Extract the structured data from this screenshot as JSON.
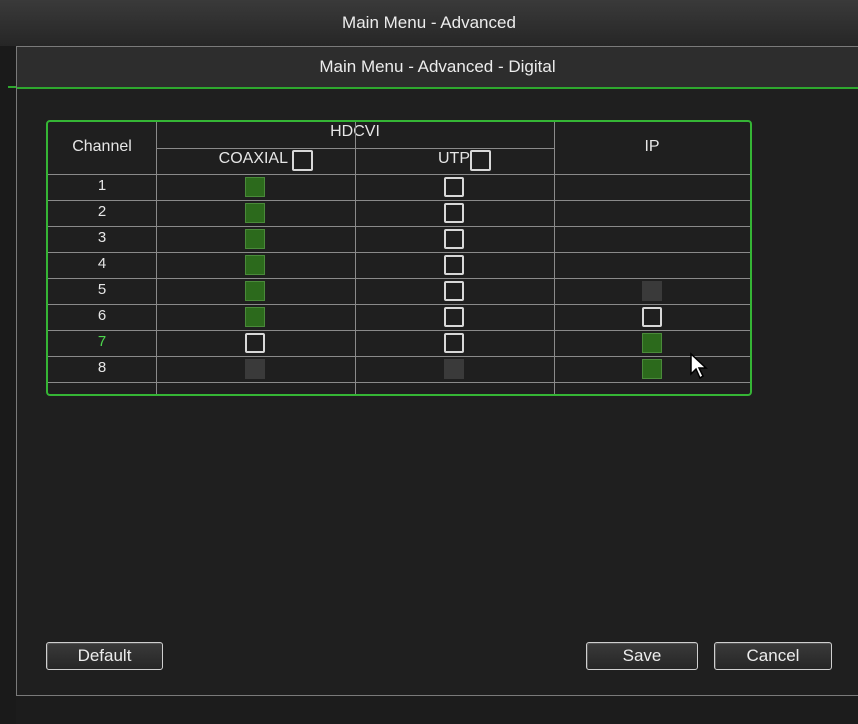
{
  "window": {
    "title": "Main Menu - Advanced"
  },
  "dialog": {
    "title": "Main Menu - Advanced - Digital"
  },
  "table": {
    "channel_header": "Channel",
    "hdcvi_header": "HDCVI",
    "coaxial_header": "COAXIAL",
    "utp_header": "UTP",
    "ip_header": "IP",
    "rows": [
      {
        "channel": "1",
        "coaxial": "on",
        "utp": "off",
        "ip": "none"
      },
      {
        "channel": "2",
        "coaxial": "on",
        "utp": "off",
        "ip": "none"
      },
      {
        "channel": "3",
        "coaxial": "on",
        "utp": "off",
        "ip": "none"
      },
      {
        "channel": "4",
        "coaxial": "on",
        "utp": "off",
        "ip": "none"
      },
      {
        "channel": "5",
        "coaxial": "on",
        "utp": "off",
        "ip": "disabled"
      },
      {
        "channel": "6",
        "coaxial": "on",
        "utp": "off",
        "ip": "off"
      },
      {
        "channel": "7",
        "coaxial": "off",
        "utp": "off",
        "ip": "on"
      },
      {
        "channel": "8",
        "coaxial": "disabled",
        "utp": "disabled",
        "ip": "on"
      }
    ],
    "active_row": "7"
  },
  "buttons": {
    "default_label": "Default",
    "save_label": "Save",
    "cancel_label": "Cancel"
  },
  "colors": {
    "accent": "#2ea82e",
    "checked": "#2c6a1c",
    "active_text": "#4dd84d"
  },
  "icons": {
    "cursor": "arrow-cursor-icon"
  }
}
